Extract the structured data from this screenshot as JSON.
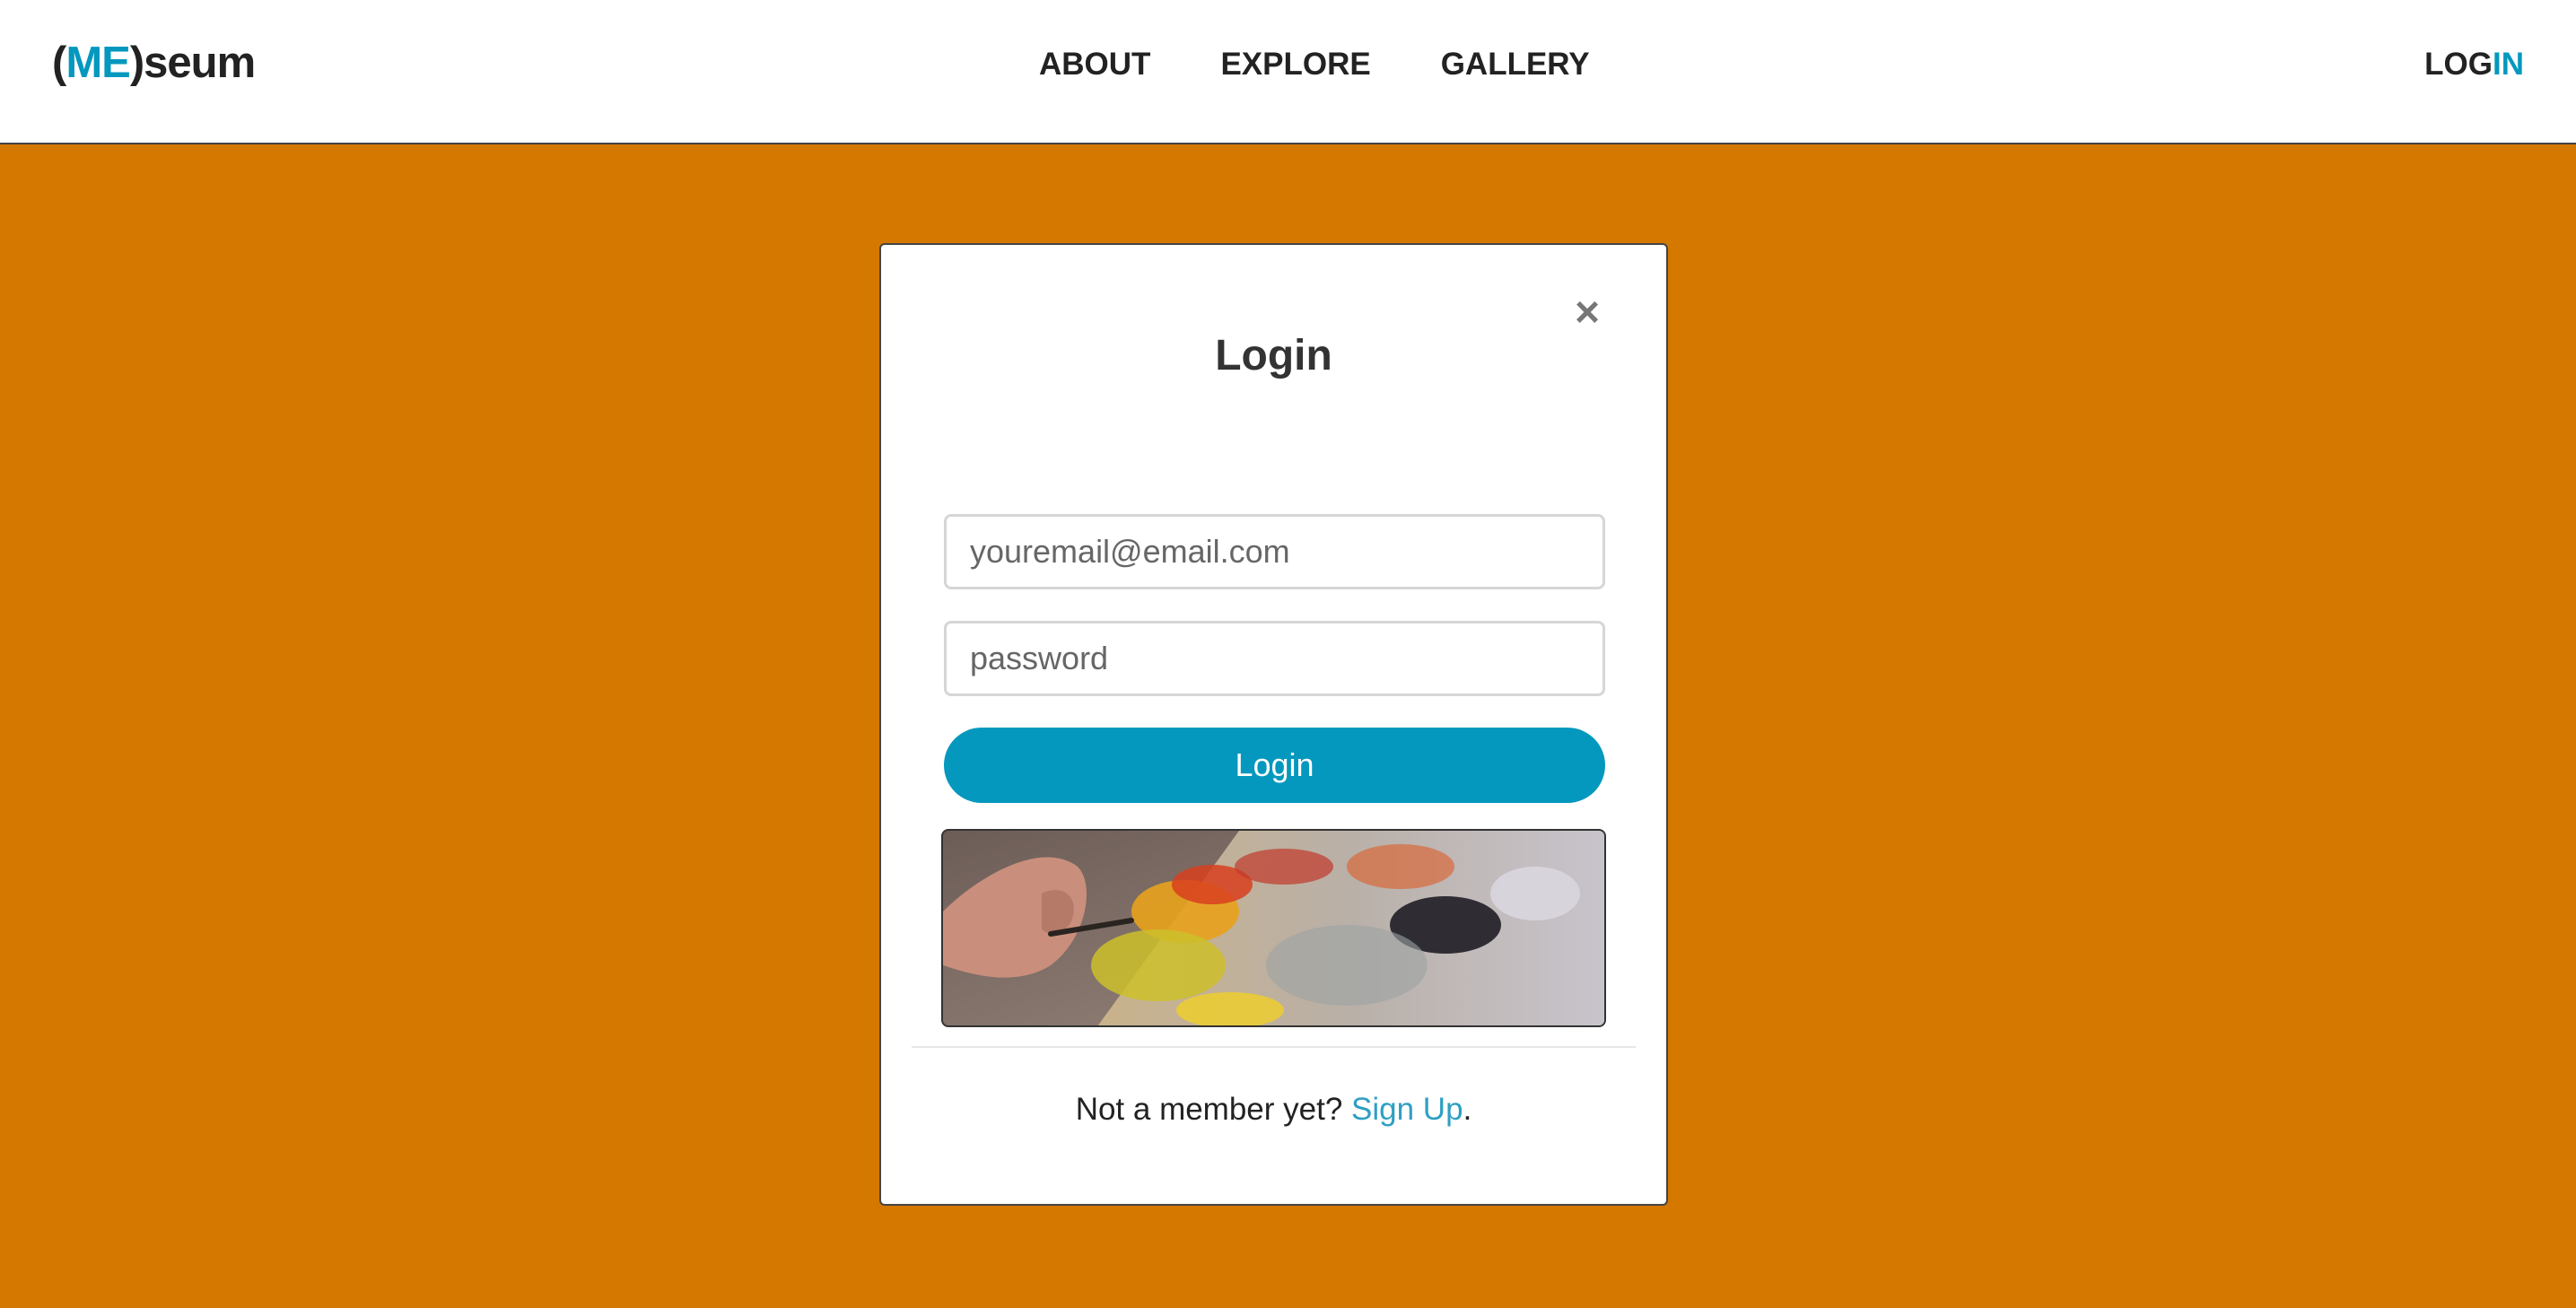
{
  "navbar": {
    "brand": {
      "open_paren": "(",
      "accent": "ME",
      "rest": ")seum"
    },
    "links": [
      "ABOUT",
      "EXPLORE",
      "GALLERY"
    ],
    "login": {
      "main": "LOG",
      "accent": "IN"
    }
  },
  "modal": {
    "close_icon": "×",
    "title": "Login",
    "email_placeholder": "youremail@email.com",
    "password_placeholder": "password",
    "submit_label": "Login",
    "footer": {
      "prompt": "Not a member yet? ",
      "link": "Sign Up",
      "suffix": "."
    }
  },
  "colors": {
    "background": "#d47800",
    "accent": "#0598be",
    "link": "#2f9fc4"
  }
}
